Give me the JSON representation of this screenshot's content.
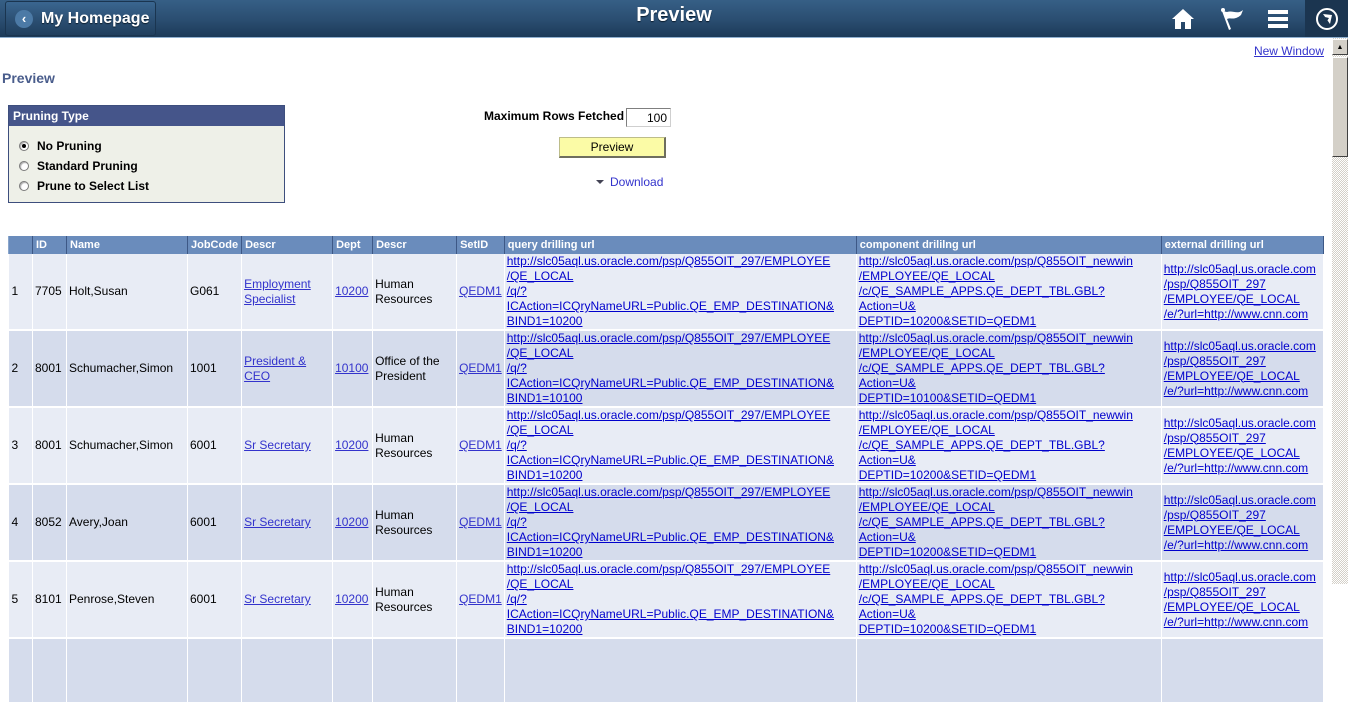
{
  "banner": {
    "back_label": "My Homepage",
    "title": "Preview",
    "icons": [
      "home-icon",
      "flag-icon",
      "menu-icon",
      "navbar-compass-icon"
    ]
  },
  "links": {
    "new_window": "New Window"
  },
  "page": {
    "title": "Preview"
  },
  "pruning": {
    "title": "Pruning Type",
    "options": [
      {
        "label": "No Pruning",
        "selected": true
      },
      {
        "label": "Standard Pruning",
        "selected": false
      },
      {
        "label": "Prune to Select List",
        "selected": false
      }
    ]
  },
  "controls": {
    "max_rows_label": "Maximum Rows Fetched",
    "max_rows_value": "100",
    "preview_button": "Preview",
    "download_label": "Download"
  },
  "table": {
    "headers": [
      "",
      "ID",
      "Name",
      "JobCode",
      "Descr",
      "Dept",
      "Descr",
      "SetID",
      "query drilling url",
      "component drililng url",
      "external drilling url"
    ],
    "rows": [
      {
        "num": "1",
        "id": "7705",
        "name": "Holt,Susan",
        "jobcode": "G061",
        "job_descr": "Employment Specialist",
        "dept": "10200",
        "dept_descr": "Human Resources",
        "setid": "QEDM1",
        "query_url": "http://slc05aql.us.oracle.com/psp/Q855OIT_297/EMPLOYEE\n/QE_LOCAL\n/q/?ICAction=ICQryNameURL=Public.QE_EMP_DESTINATION&\nBIND1=10200",
        "component_url": "http://slc05aql.us.oracle.com/psp/Q855OIT_newwin\n/EMPLOYEE/QE_LOCAL\n/c/QE_SAMPLE_APPS.QE_DEPT_TBL.GBL?Action=U&\nDEPTID=10200&SETID=QEDM1",
        "external_url": "http://slc05aql.us.oracle.com\n/psp/Q855OIT_297\n/EMPLOYEE/QE_LOCAL\n/e/?url=http://www.cnn.com"
      },
      {
        "num": "2",
        "id": "8001",
        "name": "Schumacher,Simon",
        "jobcode": "1001",
        "job_descr": "President & CEO",
        "dept": "10100",
        "dept_descr": "Office of the President",
        "setid": "QEDM1",
        "query_url": "http://slc05aql.us.oracle.com/psp/Q855OIT_297/EMPLOYEE\n/QE_LOCAL\n/q/?ICAction=ICQryNameURL=Public.QE_EMP_DESTINATION&\nBIND1=10100",
        "component_url": "http://slc05aql.us.oracle.com/psp/Q855OIT_newwin\n/EMPLOYEE/QE_LOCAL\n/c/QE_SAMPLE_APPS.QE_DEPT_TBL.GBL?Action=U&\nDEPTID=10100&SETID=QEDM1",
        "external_url": "http://slc05aql.us.oracle.com\n/psp/Q855OIT_297\n/EMPLOYEE/QE_LOCAL\n/e/?url=http://www.cnn.com"
      },
      {
        "num": "3",
        "id": "8001",
        "name": "Schumacher,Simon",
        "jobcode": "6001",
        "job_descr": "Sr Secretary",
        "dept": "10200",
        "dept_descr": "Human Resources",
        "setid": "QEDM1",
        "query_url": "http://slc05aql.us.oracle.com/psp/Q855OIT_297/EMPLOYEE\n/QE_LOCAL\n/q/?ICAction=ICQryNameURL=Public.QE_EMP_DESTINATION&\nBIND1=10200",
        "component_url": "http://slc05aql.us.oracle.com/psp/Q855OIT_newwin\n/EMPLOYEE/QE_LOCAL\n/c/QE_SAMPLE_APPS.QE_DEPT_TBL.GBL?Action=U&\nDEPTID=10200&SETID=QEDM1",
        "external_url": "http://slc05aql.us.oracle.com\n/psp/Q855OIT_297\n/EMPLOYEE/QE_LOCAL\n/e/?url=http://www.cnn.com"
      },
      {
        "num": "4",
        "id": "8052",
        "name": "Avery,Joan",
        "jobcode": "6001",
        "job_descr": "Sr Secretary",
        "dept": "10200",
        "dept_descr": "Human Resources",
        "setid": "QEDM1",
        "query_url": "http://slc05aql.us.oracle.com/psp/Q855OIT_297/EMPLOYEE\n/QE_LOCAL\n/q/?ICAction=ICQryNameURL=Public.QE_EMP_DESTINATION&\nBIND1=10200",
        "component_url": "http://slc05aql.us.oracle.com/psp/Q855OIT_newwin\n/EMPLOYEE/QE_LOCAL\n/c/QE_SAMPLE_APPS.QE_DEPT_TBL.GBL?Action=U&\nDEPTID=10200&SETID=QEDM1",
        "external_url": "http://slc05aql.us.oracle.com\n/psp/Q855OIT_297\n/EMPLOYEE/QE_LOCAL\n/e/?url=http://www.cnn.com"
      },
      {
        "num": "5",
        "id": "8101",
        "name": "Penrose,Steven",
        "jobcode": "6001",
        "job_descr": "Sr Secretary",
        "dept": "10200",
        "dept_descr": "Human Resources",
        "setid": "QEDM1",
        "query_url": "http://slc05aql.us.oracle.com/psp/Q855OIT_297/EMPLOYEE\n/QE_LOCAL\n/q/?ICAction=ICQryNameURL=Public.QE_EMP_DESTINATION&\nBIND1=10200",
        "component_url": "http://slc05aql.us.oracle.com/psp/Q855OIT_newwin\n/EMPLOYEE/QE_LOCAL\n/c/QE_SAMPLE_APPS.QE_DEPT_TBL.GBL?Action=U&\nDEPTID=10200&SETID=QEDM1",
        "external_url": "http://slc05aql.us.oracle.com\n/psp/Q855OIT_297\n/EMPLOYEE/QE_LOCAL\n/e/?url=http://www.cnn.com"
      },
      {
        "num": "",
        "id": "",
        "name": "",
        "jobcode": "",
        "job_descr": "",
        "dept": "",
        "dept_descr": "",
        "setid": "",
        "query_url": "",
        "component_url": "",
        "external_url": ""
      }
    ]
  },
  "colors": {
    "banner": "#2a4d70",
    "header_bg": "#6a8cbc",
    "row_light": "#e8ecf5",
    "row_dark": "#d5dcec",
    "link": "#3333cc",
    "preview_button": "#fbfba6"
  }
}
